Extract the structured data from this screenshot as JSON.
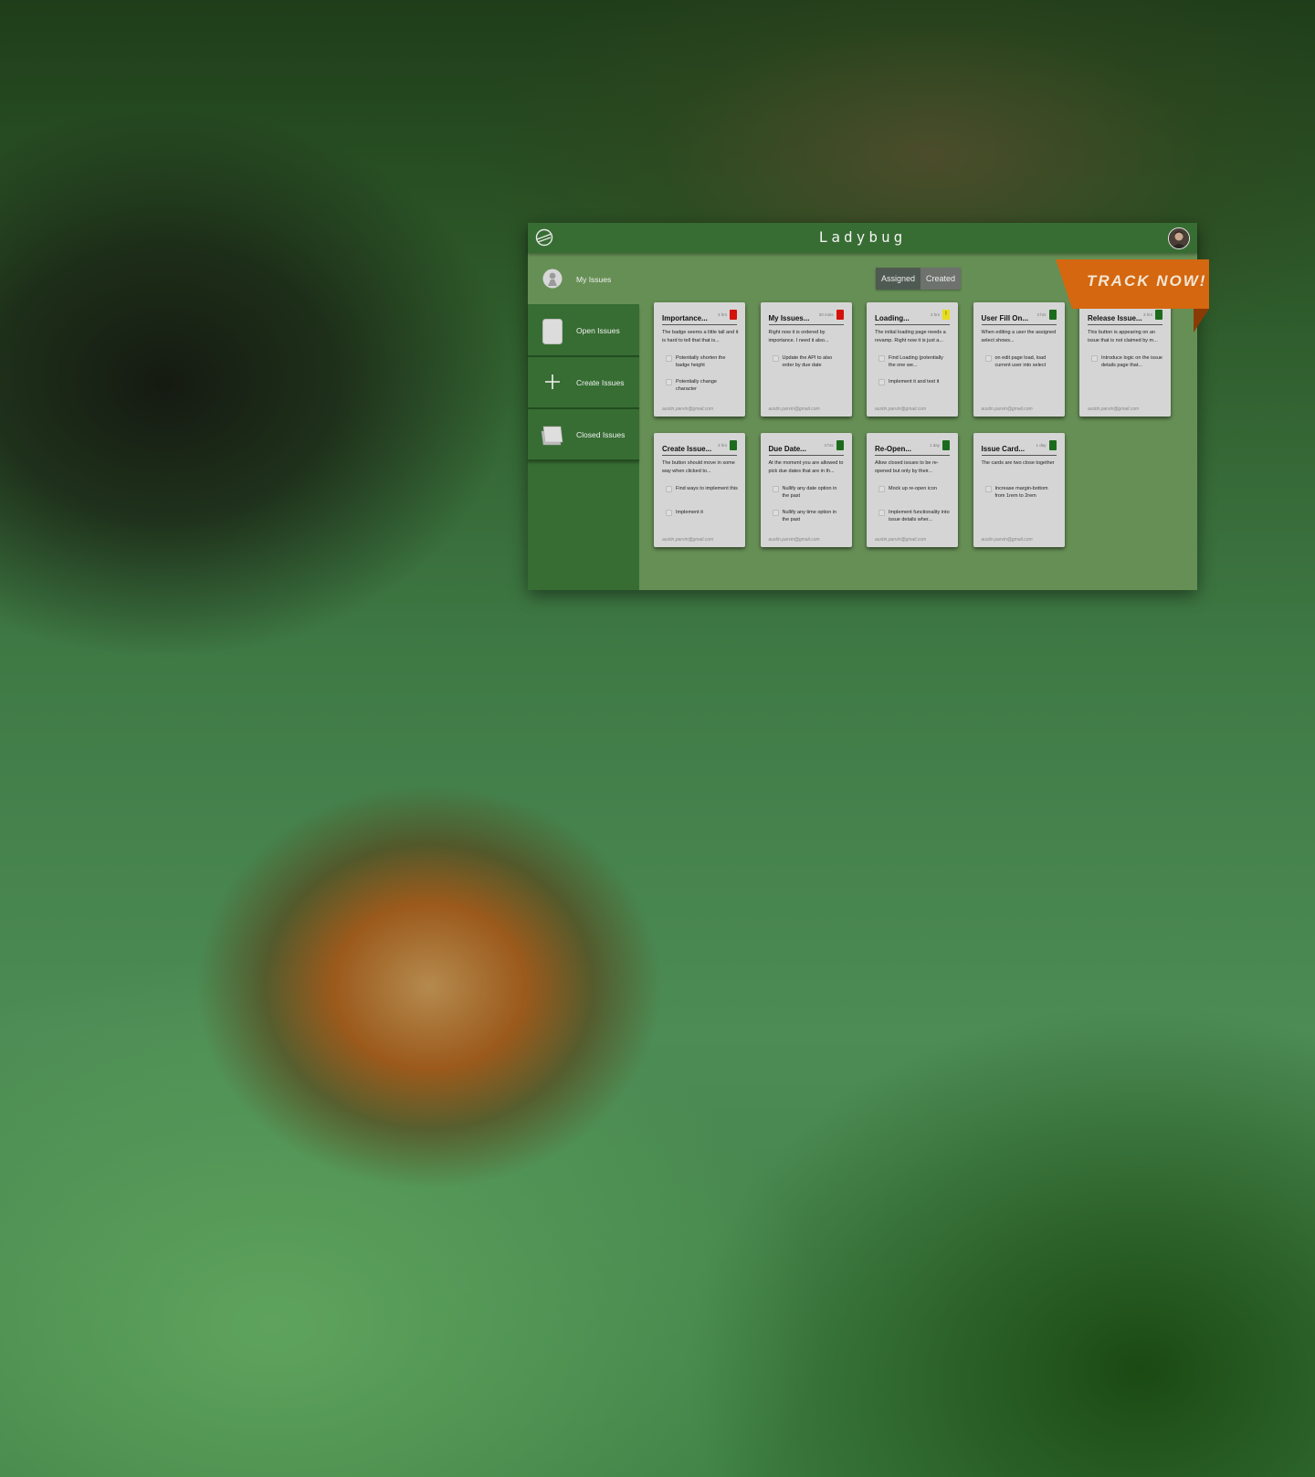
{
  "app": {
    "title": "Ladybug",
    "banner": "TRACK NOW!"
  },
  "sidebar": {
    "my_issues": "My Issues",
    "items": [
      {
        "label": "Open Issues",
        "icon": "card-icon"
      },
      {
        "label": "Create Issues",
        "icon": "plus-icon"
      },
      {
        "label": "Closed Issues",
        "icon": "stacked-cards-icon"
      }
    ]
  },
  "toggle": {
    "assigned": "Assigned",
    "created": "Created"
  },
  "colors": {
    "header": "#376d33",
    "content": "#668f55",
    "banner": "#d4670f",
    "badge_red": "#d4120c",
    "badge_yellow": "#e8dd1a",
    "badge_green": "#1c6b1c"
  },
  "cards": [
    {
      "title": "Importance...",
      "time": "3 hrs",
      "badge": "red",
      "badge_text": "",
      "description": "The badge seems a little tall and it is hard to tell that that is...",
      "tasks": [
        "Potentially shorten the badge height",
        "Potentially change character"
      ],
      "email": "austin.parvin@gmail.com"
    },
    {
      "title": "My Issues...",
      "time": "20 mins",
      "badge": "red",
      "badge_text": "",
      "description": "Right now it is ordered by importance. I need it also...",
      "tasks": [
        "Update the API to also order by due date"
      ],
      "email": "austin.parvin@gmail.com"
    },
    {
      "title": "Loading...",
      "time": "3 hrs",
      "badge": "yellow",
      "badge_text": "!",
      "description": "The initial loading page needs a revamp. Right now it is just a...",
      "tasks": [
        "Find Loading (potentially the one we...",
        "Implement it and test it"
      ],
      "email": "austin.parvin@gmail.com"
    },
    {
      "title": "User Fill On...",
      "time": "3 hrs",
      "badge": "green",
      "badge_text": "",
      "description": "When editing a user the assigned select shows...",
      "tasks": [
        "on edit page load, load current user into select"
      ],
      "email": "austin.parvin@gmail.com"
    },
    {
      "title": "Release Issue...",
      "time": "3 hrs",
      "badge": "green",
      "badge_text": "",
      "description": "This button is appearing on an issue that is not claimed by m...",
      "tasks": [
        "Introduce logic on the issue details page that..."
      ],
      "email": "austin.parvin@gmail.com"
    },
    {
      "title": "Create Issue...",
      "time": "3 hrs",
      "badge": "green",
      "badge_text": "",
      "description": "The button should move in some way when clicked to...",
      "tasks": [
        "Find ways to implement this",
        "Implement it"
      ],
      "email": "austin.parvin@gmail.com"
    },
    {
      "title": "Due Date...",
      "time": "3 hrs",
      "badge": "green",
      "badge_text": "",
      "description": "At the moment you are allowed to pick due dates that are in th...",
      "tasks": [
        "Nullify any date option in the past",
        "Nullify any time option in the past"
      ],
      "email": "austin.parvin@gmail.com"
    },
    {
      "title": "Re-Open...",
      "time": "1 day",
      "badge": "green",
      "badge_text": "",
      "description": "Allow closed issues to be re-opened but only by their...",
      "tasks": [
        "Mock up re-open icon",
        "Implement functionality into issue details wher..."
      ],
      "email": "austin.parvin@gmail.com"
    },
    {
      "title": "Issue Card...",
      "time": "1 day",
      "badge": "green",
      "badge_text": "",
      "description": "The cards are two close together",
      "tasks": [
        "Increase margin-bottom from 1rem to 2rem"
      ],
      "email": "austin.parvin@gmail.com"
    }
  ]
}
